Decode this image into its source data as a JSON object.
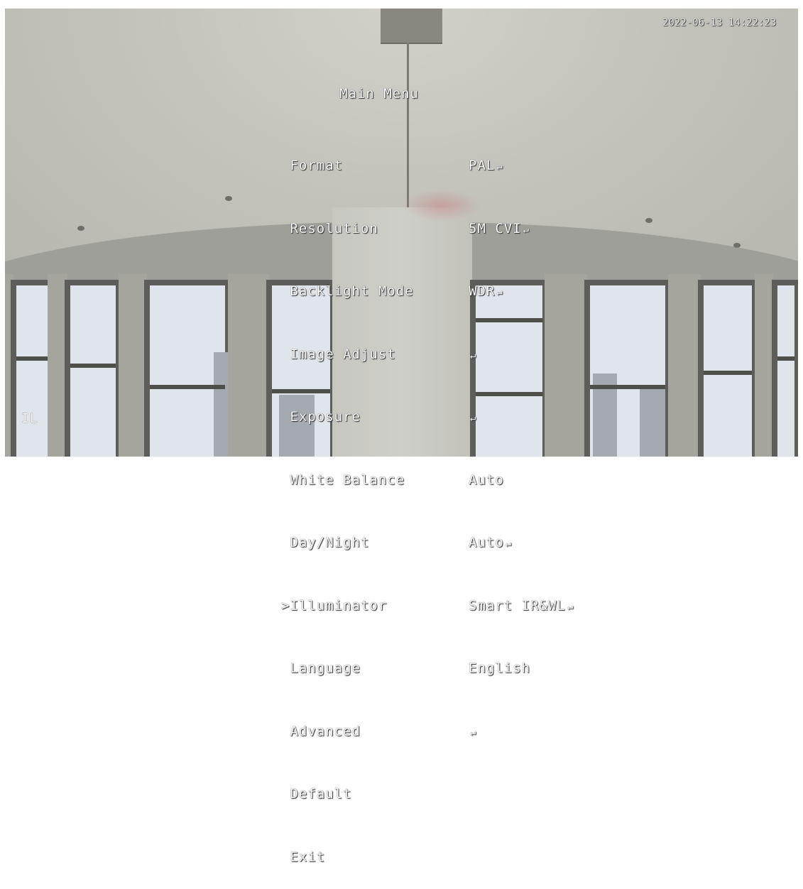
{
  "osd": {
    "timestamp": "2022-06-13 14:22:23",
    "title": "Main Menu",
    "cursor": ">",
    "selected_index": 7,
    "items": [
      {
        "label": "Format",
        "value": "PAL",
        "submenu": true
      },
      {
        "label": "Resolution",
        "value": "5M CVI",
        "submenu": true
      },
      {
        "label": "Backlight Mode",
        "value": "WDR",
        "submenu": true
      },
      {
        "label": "Image Adjust",
        "value": "",
        "submenu": true
      },
      {
        "label": "Exposure",
        "value": "",
        "submenu": true
      },
      {
        "label": "White Balance",
        "value": "Auto",
        "submenu": false
      },
      {
        "label": "Day/Night",
        "value": "Auto",
        "submenu": true
      },
      {
        "label": "Illuminator",
        "value": "Smart IR&WL",
        "submenu": true
      },
      {
        "label": "Language",
        "value": "English",
        "submenu": false
      },
      {
        "label": "Advanced",
        "value": "",
        "submenu": true
      },
      {
        "label": "Default",
        "value": "",
        "submenu": false
      },
      {
        "label": "Exit",
        "value": "",
        "submenu": false
      }
    ],
    "corner_label": "IL"
  }
}
